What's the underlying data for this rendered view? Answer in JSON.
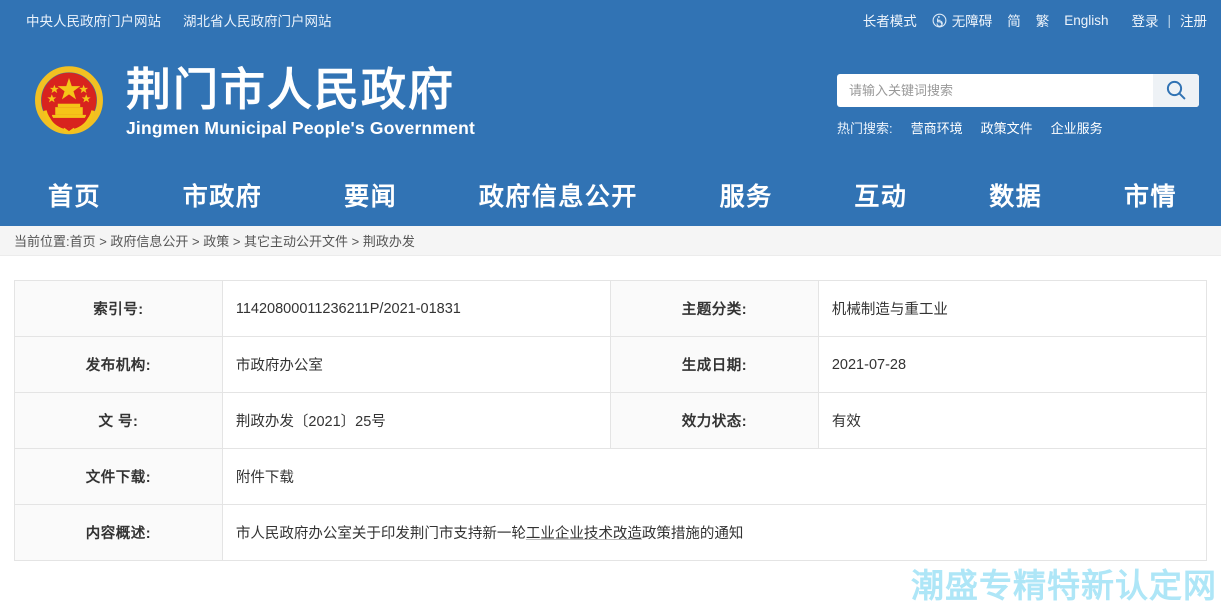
{
  "colors": {
    "header_blue": "#3173b4",
    "breadcrumb_bg": "#f5f5f5",
    "table_label_bg": "#fafafa",
    "watermark": "#aee6f7"
  },
  "topbar": {
    "left_links": [
      "中央人民政府门户网站",
      "湖北省人民政府门户网站"
    ],
    "elder_mode": "长者模式",
    "accessibility_icon": "wheelchair-icon",
    "accessibility": "无障碍",
    "simplified": "简",
    "traditional": "繁",
    "english": "English",
    "login": "登录",
    "separator": "|",
    "register": "注册"
  },
  "brand": {
    "emblem_icon": "national-emblem-icon",
    "title_cn": "荆门市人民政府",
    "title_en": "Jingmen Municipal People's Government"
  },
  "search": {
    "placeholder": "请输入关键词搜索",
    "value": "",
    "search_icon": "search-icon",
    "hot_label": "热门搜索:",
    "hot_items": [
      "营商环境",
      "政策文件",
      "企业服务"
    ]
  },
  "nav": {
    "items": [
      "首页",
      "市政府",
      "要闻",
      "政府信息公开",
      "服务",
      "互动",
      "数据",
      "市情"
    ]
  },
  "breadcrumb": {
    "text": "当前位置:首页 > 政府信息公开 > 政策 > 其它主动公开文件 > 荆政办发"
  },
  "info_table": {
    "rows": [
      {
        "label_left": "索引号:",
        "value_left": "11420800011236211P/2021-01831",
        "label_right": "主题分类:",
        "value_right": "机械制造与重工业"
      },
      {
        "label_left": "发布机构:",
        "value_left": "市政府办公室",
        "label_right": "生成日期:",
        "value_right": "2021-07-28"
      },
      {
        "label_left": "文  号:",
        "value_left": "荆政办发〔2021〕25号",
        "label_right": "效力状态:",
        "value_right": "有效"
      }
    ],
    "download_label": "文件下载:",
    "download_value": "附件下载",
    "summary_label": "内容概述:",
    "summary_value_pre": "市人民政府办公室关于印发荆门市支持新一轮",
    "summary_value_underlined": "工业企业技术改造",
    "summary_value_post": "政策措施的通知"
  },
  "watermark": {
    "text": "潮盛专精特新认定网"
  }
}
